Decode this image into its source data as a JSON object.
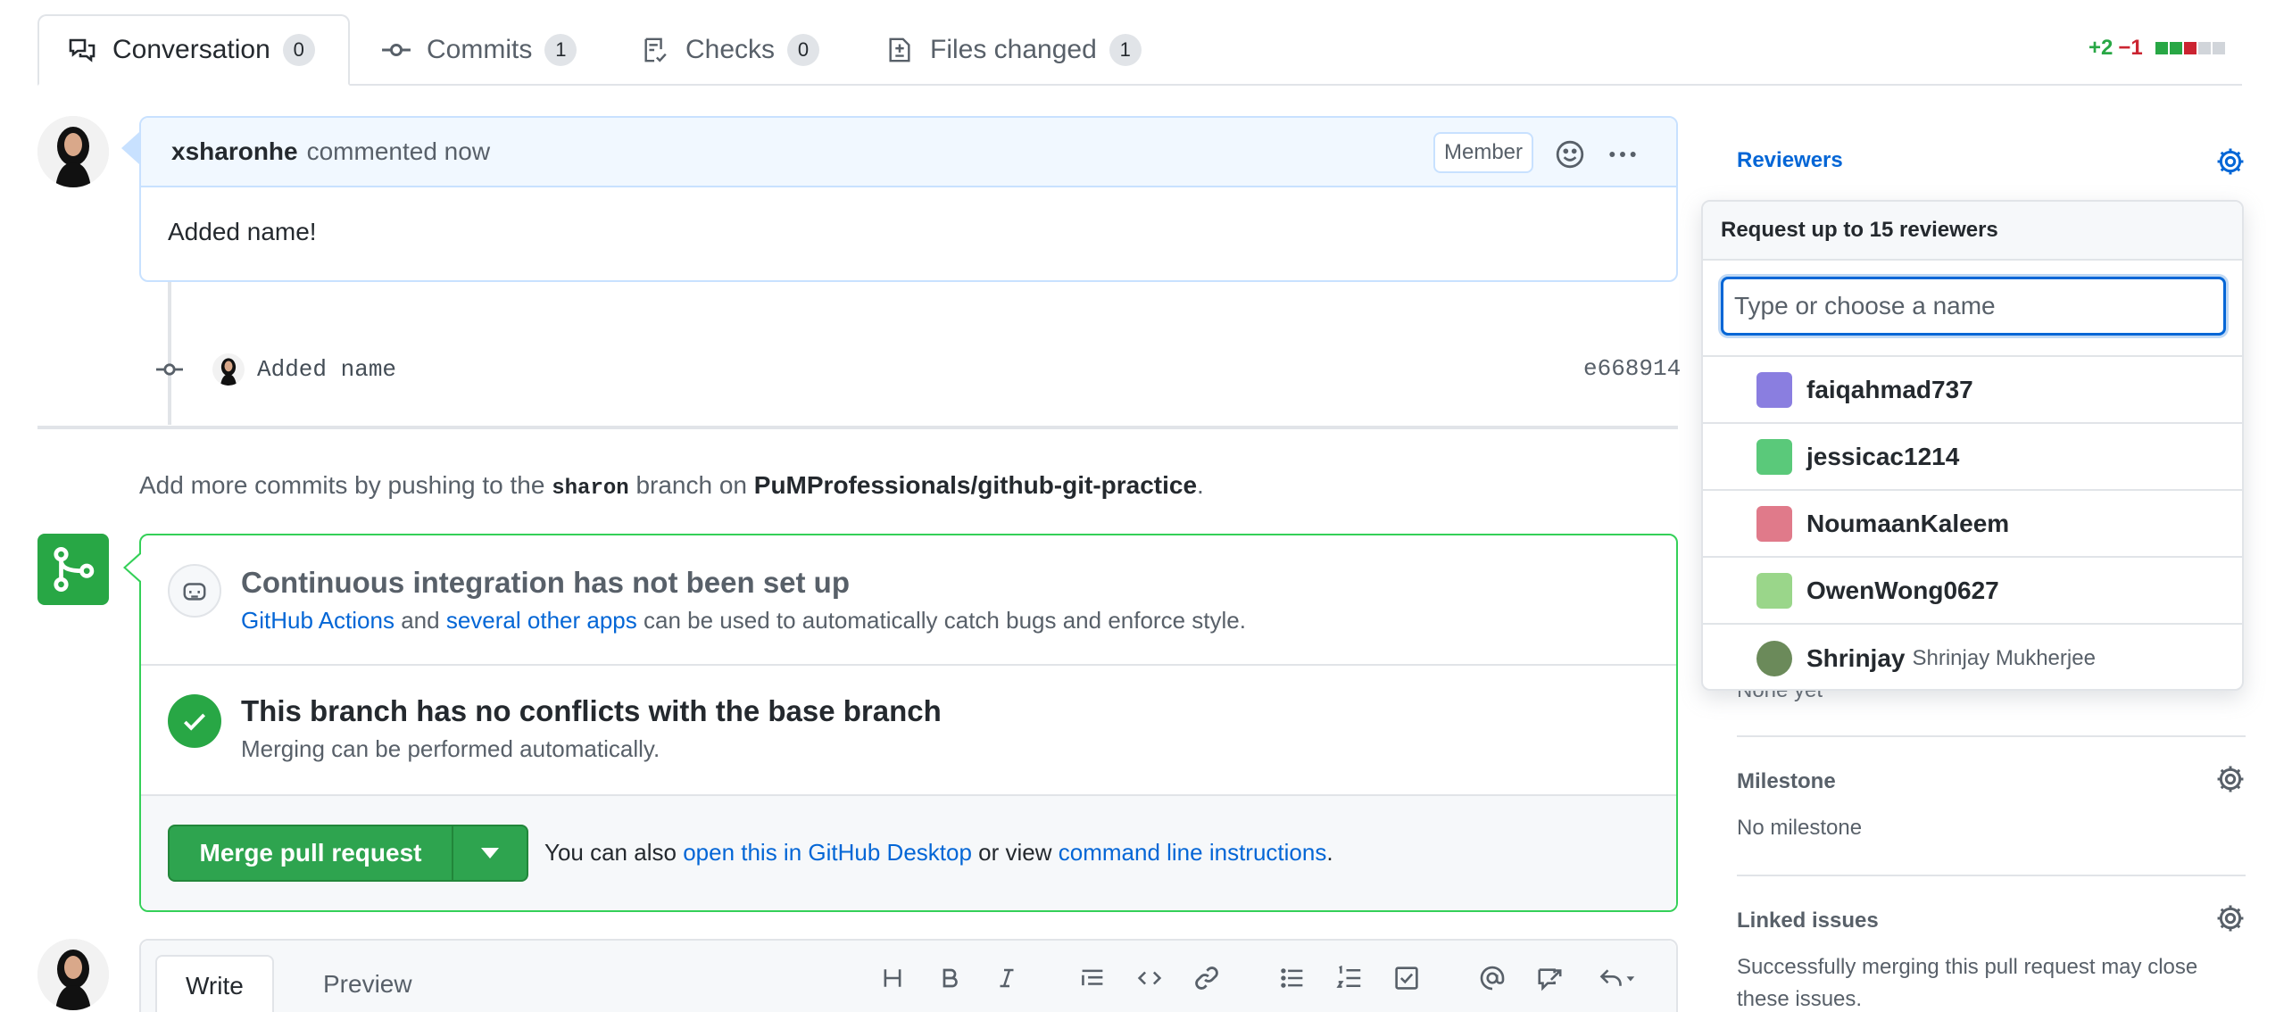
{
  "tabs": [
    {
      "label": "Conversation",
      "count": "0"
    },
    {
      "label": "Commits",
      "count": "1"
    },
    {
      "label": "Checks",
      "count": "0"
    },
    {
      "label": "Files changed",
      "count": "1"
    }
  ],
  "diffstat": {
    "additions": "+2",
    "deletions": "−1",
    "colors": [
      "#28a745",
      "#28a745",
      "#cb2431",
      "#d1d5da",
      "#d1d5da"
    ]
  },
  "comment": {
    "author": "xsharonhe",
    "meta": "commented now",
    "badge": "Member",
    "body": "Added name!"
  },
  "commit": {
    "message": "Added name",
    "sha": "e668914"
  },
  "push_info": {
    "prefix": "Add more commits by pushing to the",
    "branch": "sharon",
    "middle": "branch on",
    "repo": "PuMProfessionals/github-git-practice",
    "suffix": "."
  },
  "merge_box": {
    "ci_title": "Continuous integration has not been set up",
    "ci_link1": "GitHub Actions",
    "ci_and": "and",
    "ci_link2": "several other apps",
    "ci_rest": "can be used to automatically catch bugs and enforce style.",
    "conflict_title": "This branch has no conflicts with the base branch",
    "conflict_sub": "Merging can be performed automatically.",
    "merge_button": "Merge pull request",
    "also_prefix": "You can also",
    "also_link1": "open this in GitHub Desktop",
    "also_or": "or view",
    "also_link2": "command line instructions",
    "also_suffix": "."
  },
  "editor": {
    "tab_write": "Write",
    "tab_preview": "Preview"
  },
  "sidebar": {
    "reviewers_title": "Reviewers",
    "reviewers_value": "None yet",
    "milestone_title": "Milestone",
    "milestone_value": "No milestone",
    "linked_title": "Linked issues",
    "linked_value_1": "Successfully merging this pull request may close",
    "linked_value_2": "these issues."
  },
  "reviewer_popup": {
    "header": "Request up to 15 reviewers",
    "placeholder": "Type or choose a name",
    "users": [
      {
        "login": "faiqahmad737",
        "name": "",
        "color": "#8a7ee0"
      },
      {
        "login": "jessicac1214",
        "name": "",
        "color": "#5ac97a"
      },
      {
        "login": "NoumaanKaleem",
        "name": "",
        "color": "#e07a8a"
      },
      {
        "login": "OwenWong0627",
        "name": "",
        "color": "#9ad68a"
      },
      {
        "login": "Shrinjay",
        "name": "Shrinjay Mukherjee",
        "color": "#6b8a5a"
      }
    ]
  }
}
